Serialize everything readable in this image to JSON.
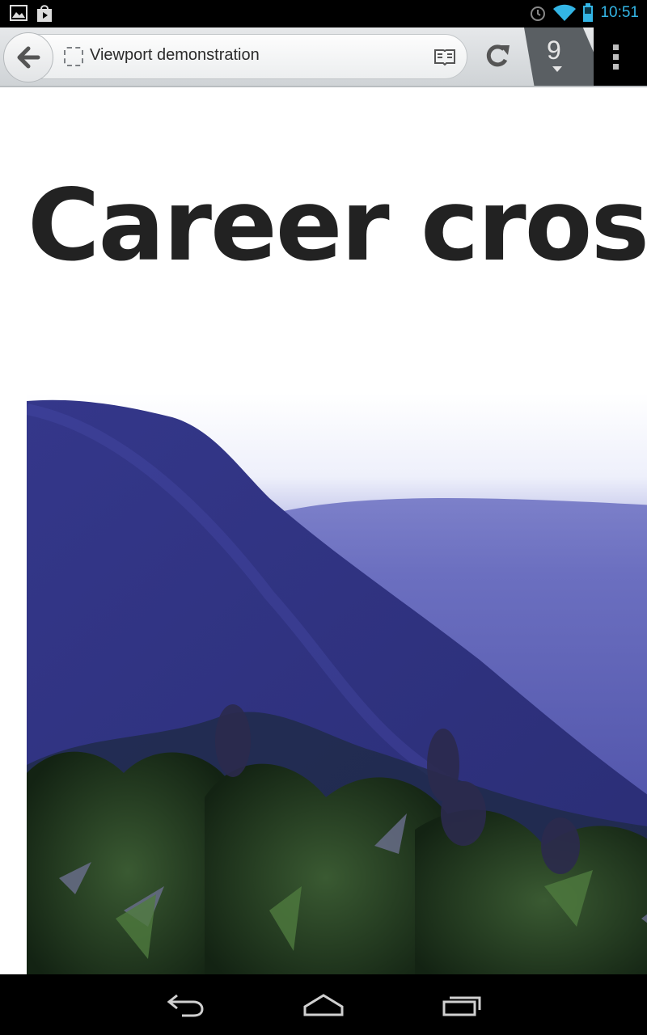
{
  "status_bar": {
    "left_icons": [
      "gallery-notification-icon",
      "play-store-notification-icon"
    ],
    "right_icons": [
      "alarm-icon",
      "wifi-icon",
      "battery-icon"
    ],
    "time": "10:51",
    "accent_color": "#33b5e5"
  },
  "browser": {
    "page_title": "Viewport demonstration",
    "tab_count": "9",
    "icons": [
      "back-arrow-icon",
      "favicon-placeholder-icon",
      "reader-mode-icon",
      "reload-icon",
      "tabs-counter",
      "overflow-menu-icon"
    ]
  },
  "page": {
    "heading": "Career cros",
    "image": {
      "description_icon": "mountain-photo",
      "colors": [
        "#2a2c7a",
        "#3d3f96",
        "#e8e9f6",
        "#1e3a1c"
      ]
    }
  },
  "nav_bar": {
    "buttons": [
      "back-nav-icon",
      "home-nav-icon",
      "recent-apps-nav-icon"
    ]
  }
}
